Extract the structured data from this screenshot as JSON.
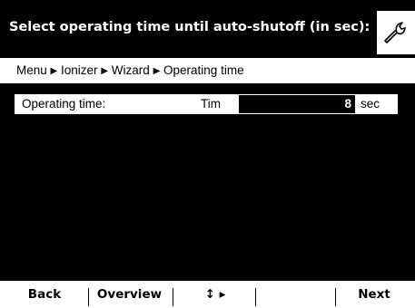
{
  "header": {
    "title": "Select operating time until auto-shutoff (in sec):",
    "tool_icon": "wrench-icon"
  },
  "breadcrumb": {
    "items": [
      "Menu",
      "Ionizer",
      "Wizard",
      "Operating time"
    ],
    "separator": "▶"
  },
  "parameter": {
    "label": "Operating time:",
    "code": "Tim",
    "value": "8",
    "unit": "sec"
  },
  "softkeys": {
    "back": "Back",
    "overview": "Overview",
    "navigate": "↕ ▸",
    "empty": "",
    "next": "Next"
  },
  "colors": {
    "background": "#000000",
    "foreground": "#ffffff"
  }
}
